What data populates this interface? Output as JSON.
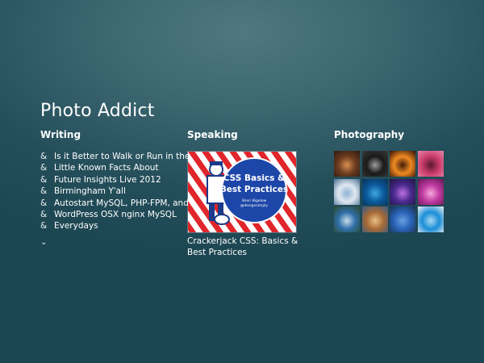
{
  "site": {
    "title": "Photo Addict"
  },
  "writing": {
    "heading": "Writing",
    "bullet": "&",
    "items": [
      "Is it Better to Walk or Run in the",
      "Little Known Facts About",
      "Future Insights Live 2012",
      "Birmingham Y'all",
      "Autostart MySQL, PHP-FPM, and",
      "WordPress OSX nginx MySQL",
      "Everydays"
    ],
    "more_glyph": "⌄"
  },
  "speaking": {
    "heading": "Speaking",
    "talk": {
      "thumb_title_line1": "CSS Basics &",
      "thumb_title_line2": "Best Practices",
      "thumb_author": "Sheri Bigelow",
      "thumb_handle": "@designsimply",
      "title": "Crackerjack CSS: Basics & Best Practices"
    }
  },
  "photography": {
    "heading": "Photography",
    "photos": [
      {
        "name": "photo-temple",
        "colors": [
          "#6e3d20",
          "#d79050",
          "#2c1a10"
        ]
      },
      {
        "name": "photo-camera",
        "colors": [
          "#1a1a1a",
          "#9c9c9c",
          "#3a3a3a"
        ]
      },
      {
        "name": "photo-silhouettes",
        "colors": [
          "#f08a22",
          "#401c08",
          "#2a0c04"
        ]
      },
      {
        "name": "photo-pink-flowers",
        "colors": [
          "#c83a6a",
          "#5a1830",
          "#e888aa"
        ]
      },
      {
        "name": "photo-snow-town",
        "colors": [
          "#dfe8f0",
          "#8fb3d6",
          "#4a6f95"
        ]
      },
      {
        "name": "photo-blue-abstract",
        "colors": [
          "#0b5a9c",
          "#3fa8e0",
          "#083055"
        ]
      },
      {
        "name": "photo-purple-tunnel",
        "colors": [
          "#4a2a90",
          "#c070e0",
          "#1e1440"
        ]
      },
      {
        "name": "photo-magenta-blossoms",
        "colors": [
          "#c03aa0",
          "#f5a8dc",
          "#601850"
        ]
      },
      {
        "name": "photo-hill-sky",
        "colors": [
          "#2f6ea8",
          "#c8dce8",
          "#2c4a2a"
        ]
      },
      {
        "name": "photo-colosseum",
        "colors": [
          "#a86a35",
          "#e9c08a",
          "#3a5a85"
        ]
      },
      {
        "name": "photo-tree-sky",
        "colors": [
          "#2a64b8",
          "#6aa0e0",
          "#1a3050"
        ]
      },
      {
        "name": "photo-pool",
        "colors": [
          "#1a8ed8",
          "#a8d8f0",
          "#f0f0f0"
        ]
      }
    ]
  }
}
